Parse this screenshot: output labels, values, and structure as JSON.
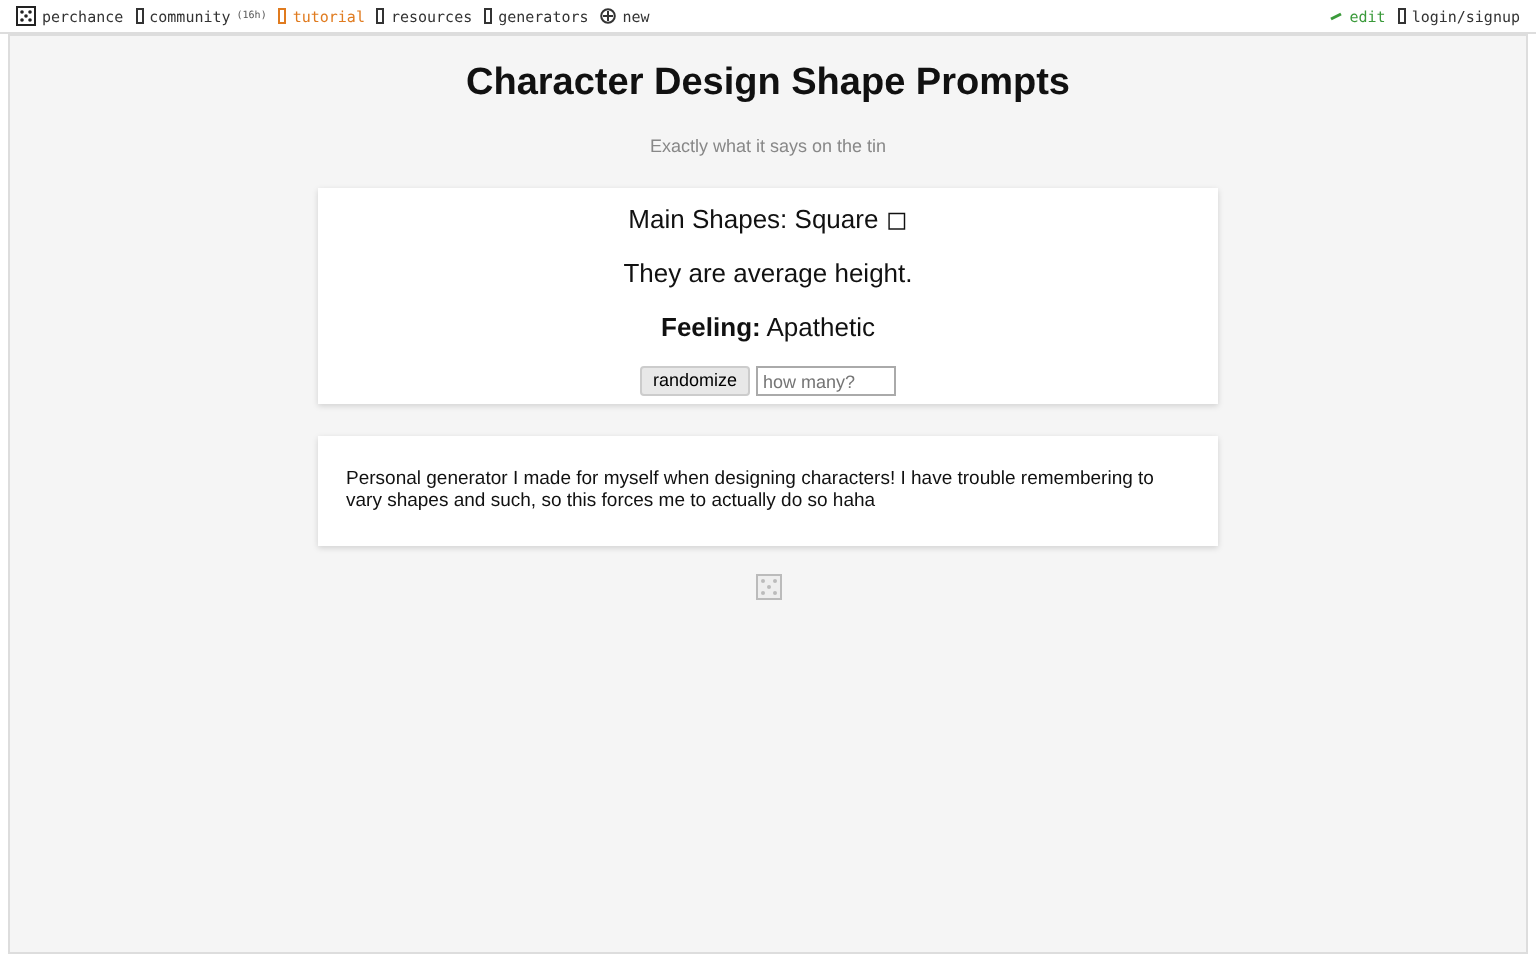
{
  "nav": {
    "left": [
      {
        "label": "perchance",
        "kind": "dice",
        "color": "#333333"
      },
      {
        "label": "community",
        "note": "(16h)",
        "kind": "box",
        "color": "#333333"
      },
      {
        "label": "tutorial",
        "kind": "box",
        "color": "#e07b1f"
      },
      {
        "label": "resources",
        "kind": "box",
        "color": "#333333"
      },
      {
        "label": "generators",
        "kind": "box",
        "color": "#333333"
      },
      {
        "label": "new",
        "kind": "plus",
        "color": "#333333"
      }
    ],
    "right": [
      {
        "label": "edit",
        "kind": "pencil",
        "color": "#3a9a3a"
      },
      {
        "label": "login/signup",
        "kind": "box",
        "color": "#333333"
      }
    ]
  },
  "title": "Character Design Shape Prompts",
  "subtitle": "Exactly what it says on the tin",
  "output": {
    "lines": [
      "Main Shapes: Square ◻",
      "They are average height.",
      "**Feeling:** Apathetic"
    ],
    "button": "randomize",
    "count_field": {
      "placeholder": "how many?"
    }
  },
  "description": "Personal generator I made for myself when designing characters! I have trouble remembering to vary shapes and such, so this forces me to actually do so haha"
}
